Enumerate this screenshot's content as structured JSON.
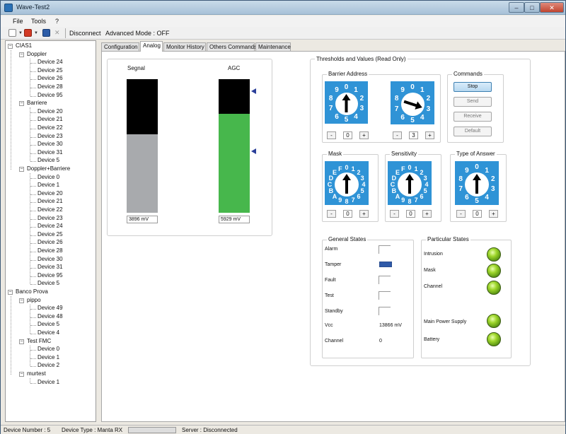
{
  "window": {
    "title": "Wave-Test2",
    "min": "–",
    "max": "□",
    "close": "✕"
  },
  "menu": [
    "File",
    "Tools",
    "?"
  ],
  "toolbar": {
    "disconnect": "Disconnect",
    "advanced_mode": "Advanced Mode : OFF"
  },
  "tree": {
    "root": "CIAS1",
    "groups": [
      {
        "label": "Doppler",
        "devices": [
          "Device 24",
          "Device 25",
          "Device 26",
          "Device 28",
          "Device 95"
        ]
      },
      {
        "label": "Barriere",
        "devices": [
          "Device 20",
          "Device 21",
          "Device 22",
          "Device 23",
          "Device 30",
          "Device 31",
          "Device 5"
        ]
      },
      {
        "label": "Doppler+Barriere",
        "devices": [
          "Device 0",
          "Device 1",
          "Device 20",
          "Device 21",
          "Device 22",
          "Device 23",
          "Device 24",
          "Device 25",
          "Device 26",
          "Device 28",
          "Device 30",
          "Device 31",
          "Device 95",
          "Device 5"
        ]
      }
    ],
    "root2": "Banco Prova",
    "groups2": [
      {
        "label": "pippo",
        "devices": [
          "Device 49",
          "Device 48",
          "Device 5",
          "Device 4"
        ]
      },
      {
        "label": "Test FMC",
        "devices": [
          "Device 0",
          "Device 1",
          "Device 2"
        ]
      },
      {
        "label": "murtest",
        "devices": [
          "Device 1"
        ]
      }
    ]
  },
  "tabs": [
    "Configuration",
    "Analog",
    "Monitor History",
    "Others Commands",
    "Maintenance"
  ],
  "active_tab": "Analog",
  "analog": {
    "signal": {
      "label": "Segnal",
      "value": "3896 mV",
      "level": 0.59,
      "color": "#a8aaad"
    },
    "agc": {
      "label": "AGC",
      "value": "5929 mV",
      "level": 0.74,
      "color": "#47b74c",
      "markers": [
        0.91,
        0.46
      ]
    }
  },
  "thresholds": {
    "title": "Thresholds and Values (Read Only)",
    "barrier_address": {
      "label": "Barrier Address",
      "dial1": {
        "digits": [
          "0",
          "1",
          "2",
          "3",
          "4",
          "5",
          "6",
          "7",
          "8",
          "9"
        ],
        "value": "0",
        "angle": 0
      },
      "dial2": {
        "digits": [
          "0",
          "1",
          "2",
          "3",
          "4",
          "5",
          "6",
          "7",
          "8",
          "9"
        ],
        "value": "3",
        "angle": 108
      }
    },
    "commands": {
      "label": "Commands",
      "stop": "Stop",
      "send": "Send",
      "receive": "Receive",
      "default": "Default"
    },
    "mask": {
      "label": "Mask",
      "digits": [
        "0",
        "1",
        "2",
        "3",
        "4",
        "5",
        "6",
        "7",
        "8",
        "9",
        "A",
        "B",
        "C",
        "D",
        "E",
        "F"
      ],
      "value": "0",
      "angle": 0
    },
    "sensitivity": {
      "label": "Sensitivity",
      "digits": [
        "0",
        "1",
        "2",
        "3",
        "4",
        "5",
        "6",
        "7",
        "8",
        "9",
        "A",
        "B",
        "C",
        "D",
        "E",
        "F"
      ],
      "value": "0",
      "angle": 0
    },
    "type_of_answer": {
      "label": "Type of Answer",
      "digits": [
        "0",
        "1",
        "2",
        "3",
        "4",
        "5",
        "6",
        "7",
        "8",
        "9"
      ],
      "value": "0",
      "angle": 0
    },
    "minus": "-",
    "plus": "+"
  },
  "general_states": {
    "label": "General States",
    "alarm": "Alarm",
    "tamper": "Tamper",
    "fault": "Fault",
    "test": "Test",
    "standby": "Standby",
    "vcc": "Vcc",
    "vcc_value": "13866 mV",
    "channel": "Channel",
    "channel_value": "0"
  },
  "particular_states": {
    "label": "Particular States",
    "intrusion": "Intrusion",
    "mask": "Mask",
    "channel": "Channel",
    "main_power": "Main Power Supply",
    "battery": "Battery"
  },
  "status": {
    "device_number": "Device Number : 5",
    "device_type": "Device Type : Manta RX",
    "server": "Server : Disconnected"
  },
  "colors": {
    "dial_blue": "#2f93d6",
    "led_green": "#8ed222",
    "tamper_on": "#2f5aa8"
  }
}
